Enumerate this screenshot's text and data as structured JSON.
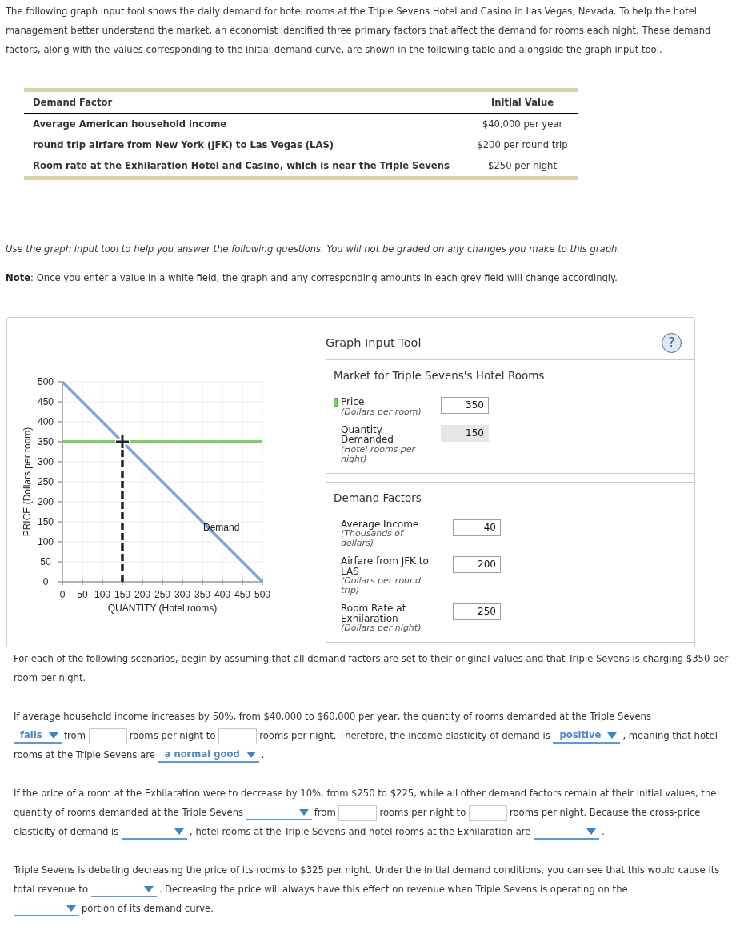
{
  "intro": "The following graph input tool shows the daily demand for hotel rooms at the Triple Sevens Hotel and Casino in Las Vegas, Nevada. To help the hotel management better understand the market, an economist identified three primary factors that affect the demand for rooms each night. These demand factors, along with the values corresponding to the initial demand curve, are shown in the following table and alongside the graph input tool.",
  "factor_table": {
    "columns": [
      "Demand Factor",
      "Initial Value"
    ],
    "rows": [
      [
        "Average American household income",
        "$40,000 per year"
      ],
      [
        "round trip airfare from New York (JFK) to Las Vegas (LAS)",
        "$200 per round trip"
      ],
      [
        "Room rate at the Exhilaration Hotel and Casino, which is near the Triple Sevens",
        "$250 per night"
      ]
    ]
  },
  "instructions": "Use the graph input tool to help you answer the following questions. You will not be graded on any changes you make to this graph.",
  "note": "**Note**: Once you enter a value in a white field, the graph and any corresponding amounts in each grey field will change accordingly.",
  "graph_tool": {
    "chart_data": {
      "type": "line",
      "xlabel": "QUANTITY (Hotel rooms)",
      "ylabel": "PRICE (Dollars per room)",
      "x": [
        0,
        500
      ],
      "series": [
        {
          "name": "Demand",
          "color": "#7ea7d2",
          "values": [
            500,
            0
          ]
        },
        {
          "color": "#7dd35a",
          "values": [
            350,
            350
          ]
        }
      ],
      "xlim": [
        0,
        500
      ],
      "ylim": [
        0,
        500
      ],
      "xticks": [
        0,
        50,
        100,
        150,
        200,
        250,
        300,
        350,
        400,
        450,
        500
      ],
      "yticks": [
        0,
        50,
        100,
        150,
        200,
        250,
        300,
        350,
        400,
        450,
        500
      ],
      "grid": true,
      "ref_lines": [
        {
          "axis": "x",
          "value": 150
        }
      ]
    },
    "title": "Graph Input Tool",
    "help": "?",
    "market": {
      "title": "Market for Triple Sevens's Hotel Rooms",
      "fields": [
        {
          "label": "Price",
          "unit": "(Dollars per room)",
          "value": "350",
          "readonly": false,
          "color": "#7dd35a"
        },
        {
          "label": "Quantity Demanded",
          "unit": "(Hotel rooms per night)",
          "value": "150",
          "readonly": true
        }
      ]
    },
    "factors": {
      "title": "Demand Factors",
      "fields": [
        {
          "label": "Average Income",
          "unit": "(Thousands of dollars)",
          "value": "40",
          "readonly": false
        },
        {
          "label": "Airfare from JFK to LAS",
          "unit": "(Dollars per round trip)",
          "value": "200",
          "readonly": false
        },
        {
          "label": "Room Rate at Exhilaration",
          "unit": "(Dollars per night)",
          "value": "250",
          "readonly": false
        }
      ]
    }
  },
  "scenario_intro": "For each of the following scenarios, begin by assuming that all demand factors are set to their original values and that Triple Sevens is charging $350 per room per night.",
  "questions": [
    {
      "parts": [
        {
          "kind": "text",
          "text": "If average household income increases by 50%, from $40,000 to $60,000 per year, the quantity of rooms demanded at the Triple Sevens"
        },
        {
          "kind": "dropdown",
          "value": "falls"
        },
        {
          "kind": "text",
          "text": "from"
        },
        {
          "kind": "blank"
        },
        {
          "kind": "text",
          "text": "rooms per night to"
        },
        {
          "kind": "blank"
        },
        {
          "kind": "text",
          "text": "rooms per night. Therefore, the income elasticity of demand is"
        },
        {
          "kind": "dropdown",
          "value": "positive"
        },
        {
          "kind": "text",
          "text": ", meaning that hotel rooms at the Triple Sevens are"
        },
        {
          "kind": "dropdown",
          "value": "a normal good"
        },
        {
          "kind": "text",
          "text": "."
        }
      ]
    },
    {
      "parts": [
        {
          "kind": "text",
          "text": "If the price of a room at the Exhilaration were to decrease by 10%, from $250 to $225, while all other demand factors remain at their initial values, the quantity of rooms demanded at the Triple Sevens"
        },
        {
          "kind": "dropdown"
        },
        {
          "kind": "text",
          "text": "from"
        },
        {
          "kind": "blank"
        },
        {
          "kind": "text",
          "text": "rooms per night to"
        },
        {
          "kind": "blank"
        },
        {
          "kind": "text",
          "text": "rooms per night. Because the cross-price elasticity of demand is"
        },
        {
          "kind": "dropdown"
        },
        {
          "kind": "text",
          "text": ", hotel rooms at the Triple Sevens and hotel rooms at the Exhilaration are"
        },
        {
          "kind": "dropdown"
        },
        {
          "kind": "text",
          "text": "."
        }
      ]
    },
    {
      "parts": [
        {
          "kind": "text",
          "text": "Triple Sevens is debating decreasing the price of its rooms to $325 per night. Under the initial demand conditions, you can see that this would cause its total revenue to"
        },
        {
          "kind": "dropdown"
        },
        {
          "kind": "text",
          "text": ". Decreasing the price will always have this effect on revenue when Triple Sevens is operating on the"
        },
        {
          "kind": "dropdown"
        },
        {
          "kind": "text",
          "text": "portion of its demand curve."
        }
      ]
    }
  ]
}
